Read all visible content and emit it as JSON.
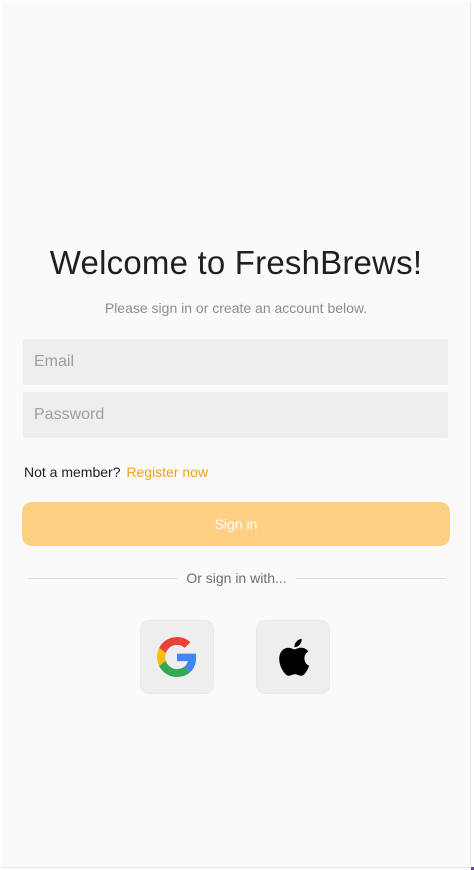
{
  "welcome": {
    "title": "Welcome to FreshBrews!",
    "subtitle": "Please sign in or create an account below."
  },
  "form": {
    "email_placeholder": "Email",
    "email_value": "",
    "password_placeholder": "Password",
    "password_value": "",
    "member_prompt": "Not a member?",
    "register_label": "Register now",
    "signin_label": "Sign in"
  },
  "social": {
    "divider_label": "Or sign in with...",
    "providers": [
      {
        "icon": "google-icon"
      },
      {
        "icon": "apple-icon"
      }
    ]
  },
  "colors": {
    "background": "#fafafa",
    "accent": "#f5a017",
    "signin_button": "#ffcf84",
    "field_background": "#eeeeee"
  }
}
